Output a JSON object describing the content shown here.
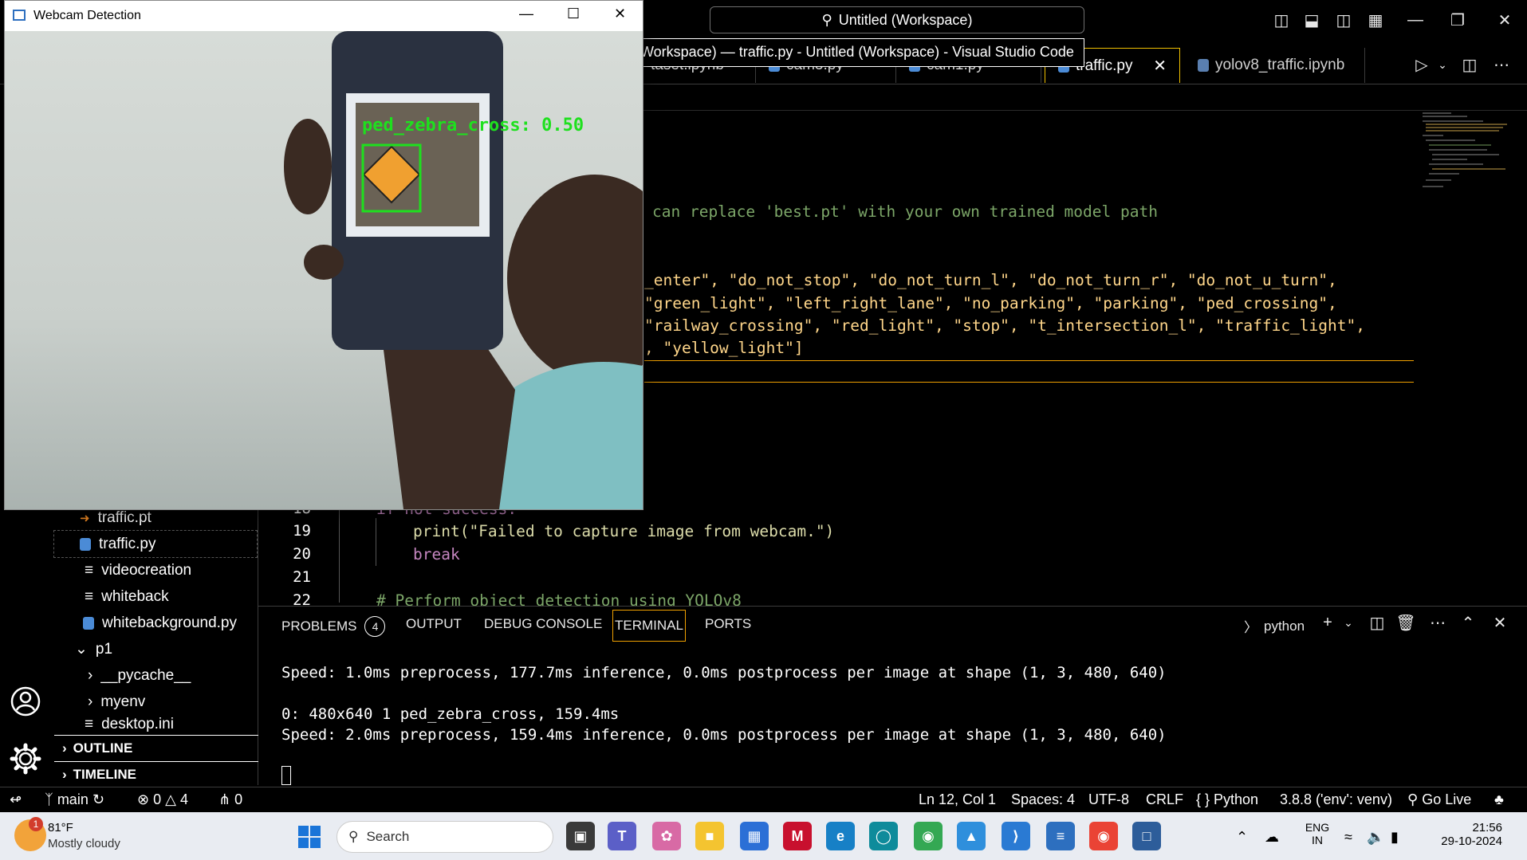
{
  "vscode": {
    "command_center": "Untitled (Workspace)",
    "tooltip": "Workspace) — traffic.py - Untitled (Workspace) - Visual Studio Code",
    "tabs": [
      {
        "label": "taset.ipynb"
      },
      {
        "label": "cam3.py"
      },
      {
        "label": "cam1.py"
      },
      {
        "label": "traffic.py",
        "active": true
      },
      {
        "label": "yolov8_traffic.ipynb"
      }
    ],
    "code": {
      "comment_line": "can replace 'best.pt' with your own trained model path",
      "list_line1": "_enter\", \"do_not_stop\", \"do_not_turn_l\", \"do_not_turn_r\", \"do_not_u_turn\",",
      "list_line2": "\"green_light\", \"left_right_lane\", \"no_parking\", \"parking\", \"ped_crossing\",",
      "list_line3": "\"railway_crossing\", \"red_light\", \"stop\", \"t_intersection_l\", \"traffic_light\",",
      "list_line4": ", \"yellow_light\"]",
      "line18": "if not success:",
      "line19": "print(\"Failed to capture image from webcam.\")",
      "line20": "break",
      "line22": "# Perform object detection using YOLOv8"
    },
    "line_numbers": [
      "18",
      "19",
      "20",
      "21",
      "22"
    ],
    "sidebar": {
      "items": [
        {
          "label": "traffic.pt",
          "icon": "rss-file-icon"
        },
        {
          "label": "traffic.py",
          "icon": "python-file-icon"
        },
        {
          "label": "videocreation",
          "icon": "text-file-icon"
        },
        {
          "label": "whiteback",
          "icon": "text-file-icon"
        },
        {
          "label": "whitebackground.py",
          "icon": "python-file-icon"
        },
        {
          "label": "p1",
          "icon": "chevron-down-icon"
        },
        {
          "label": "__pycache__",
          "icon": "chevron-right-icon"
        },
        {
          "label": "myenv",
          "icon": "chevron-right-icon"
        },
        {
          "label": "desktop.ini",
          "icon": "text-file-icon"
        }
      ],
      "outline": "OUTLINE",
      "timeline": "TIMELINE"
    },
    "panel": {
      "tabs": [
        "PROBLEMS",
        "OUTPUT",
        "DEBUG CONSOLE",
        "TERMINAL",
        "PORTS"
      ],
      "problems_count": "4",
      "shell": "python",
      "terminal_lines": [
        "Speed: 1.0ms preprocess, 177.7ms inference, 0.0ms postprocess per image at shape (1, 3, 480, 640)",
        "",
        "0: 480x640 1 ped_zebra_cross, 159.4ms",
        "Speed: 2.0ms preprocess, 159.4ms inference, 0.0ms postprocess per image at shape (1, 3, 480, 640)"
      ]
    },
    "status": {
      "branch": "main",
      "errors": "0",
      "warnings": "4",
      "ports": "0",
      "position": "Ln 12, Col 1",
      "spaces": "Spaces: 4",
      "encoding": "UTF-8",
      "eol": "CRLF",
      "language": "Python",
      "interpreter": "3.8.8 ('env': venv)",
      "golive": "Go Live"
    }
  },
  "webcam": {
    "title": "Webcam Detection",
    "detection_label": "ped_zebra_cross: 0.50",
    "box_color": "#1ee01e"
  },
  "taskbar": {
    "weather_temp": "81°F",
    "weather_desc": "Mostly cloudy",
    "weather_badge": "1",
    "search_placeholder": "Search",
    "lang1": "ENG",
    "lang2": "IN",
    "time": "21:56",
    "date": "29-10-2024"
  },
  "colors": {
    "accent": "#f0a000",
    "string": "#ffd68a",
    "comment": "#7ca668",
    "keyword": "#c586c0"
  }
}
